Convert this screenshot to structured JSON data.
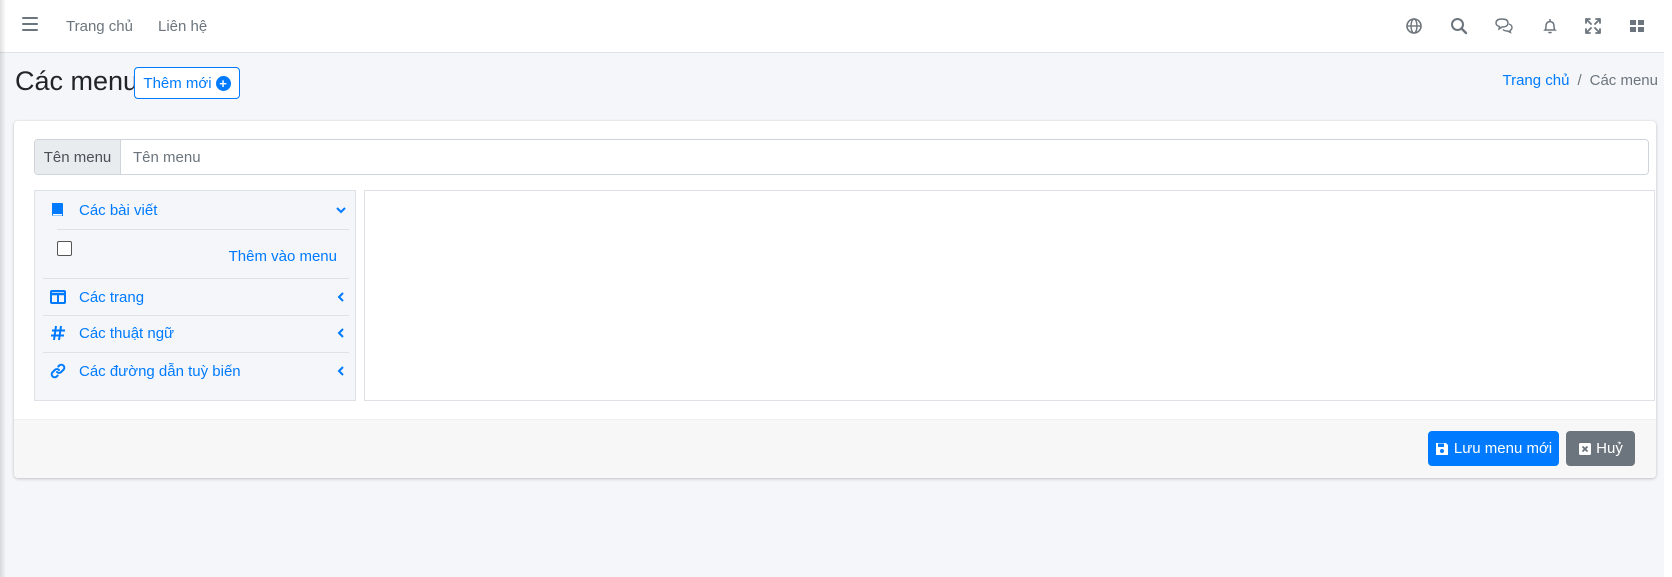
{
  "navbar": {
    "home_label": "Trang chủ",
    "contact_label": "Liên hệ",
    "icons": [
      "menu-icon",
      "globe-icon",
      "search-icon",
      "comments-icon",
      "bell-icon",
      "expand-icon",
      "grid-icon"
    ]
  },
  "header": {
    "title": "Các menu",
    "add_button_label": "Thêm mới",
    "breadcrumb": {
      "home": "Trang chủ",
      "separator": "/",
      "current": "Các menu"
    }
  },
  "form": {
    "name_label": "Tên menu",
    "name_placeholder": "Tên menu",
    "name_value": ""
  },
  "accordion": {
    "items": [
      {
        "label": "Các bài viết",
        "icon": "book-icon",
        "expanded": true
      },
      {
        "label": "Các trang",
        "icon": "columns-icon",
        "expanded": false
      },
      {
        "label": "Các thuật ngữ",
        "icon": "hashtag-icon",
        "expanded": false
      },
      {
        "label": "Các đường dẫn tuỳ biến",
        "icon": "link-icon",
        "expanded": false
      }
    ],
    "add_to_menu_label": "Thêm vào menu"
  },
  "footer": {
    "save_label": "Lưu menu mới",
    "cancel_label": "Huỷ"
  },
  "colors": {
    "primary": "#007bff",
    "secondary": "#6c757d",
    "background": "#f4f6f9"
  }
}
